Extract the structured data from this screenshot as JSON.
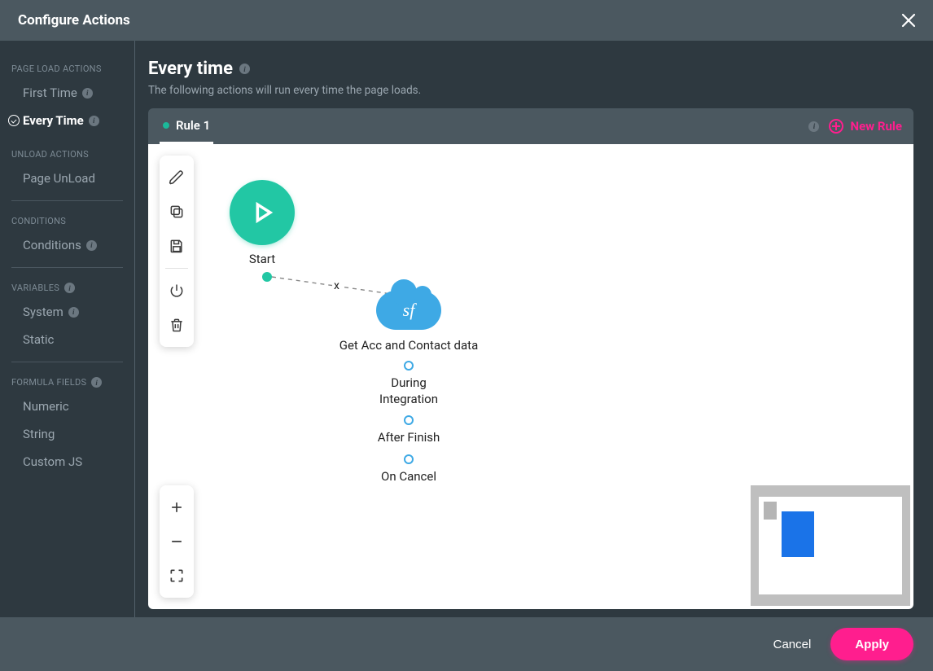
{
  "dialog": {
    "title": "Configure Actions"
  },
  "sidebar": {
    "sections": [
      {
        "title": "PAGE LOAD ACTIONS",
        "items": [
          {
            "label": "First Time",
            "info": true,
            "active": false
          },
          {
            "label": "Every Time",
            "info": true,
            "active": true
          }
        ]
      },
      {
        "title": "UNLOAD ACTIONS",
        "items": [
          {
            "label": "Page UnLoad",
            "info": false,
            "active": false
          }
        ]
      },
      {
        "title": "CONDITIONS",
        "items": [
          {
            "label": "Conditions",
            "info": true,
            "active": false
          }
        ]
      },
      {
        "title": "VARIABLES",
        "title_info": true,
        "items": [
          {
            "label": "System",
            "info": true,
            "active": false
          },
          {
            "label": "Static",
            "info": false,
            "active": false
          }
        ]
      },
      {
        "title": "FORMULA FIELDS",
        "title_info": true,
        "items": [
          {
            "label": "Numeric",
            "info": false,
            "active": false
          },
          {
            "label": "String",
            "info": false,
            "active": false
          },
          {
            "label": "Custom JS",
            "info": false,
            "active": false
          }
        ]
      }
    ]
  },
  "main": {
    "title": "Every time",
    "subtitle": "The following actions will run every time the page loads.",
    "tabs": [
      {
        "label": "Rule 1",
        "active": true
      }
    ],
    "new_rule_label": "New Rule"
  },
  "flow": {
    "start_label": "Start",
    "connector_symbol": "x",
    "action": {
      "icon_text": "sf",
      "label": "Get Acc and Contact data",
      "ports": [
        {
          "label": "During\nIntegration"
        },
        {
          "label": "After Finish"
        },
        {
          "label": "On Cancel"
        }
      ]
    }
  },
  "toolbars": {
    "top": [
      "edit-icon",
      "copy-icon",
      "save-icon",
      "power-icon",
      "trash-icon"
    ],
    "bottom": [
      "zoom-in-icon",
      "zoom-out-icon",
      "fit-icon"
    ]
  },
  "footer": {
    "cancel_label": "Cancel",
    "apply_label": "Apply"
  },
  "colors": {
    "accent_pink": "#ff1e8e",
    "accent_teal": "#22c7a4",
    "sf_blue": "#3ea9e5",
    "bg_dark": "#2e3940",
    "bg_mid": "#4b5860"
  }
}
